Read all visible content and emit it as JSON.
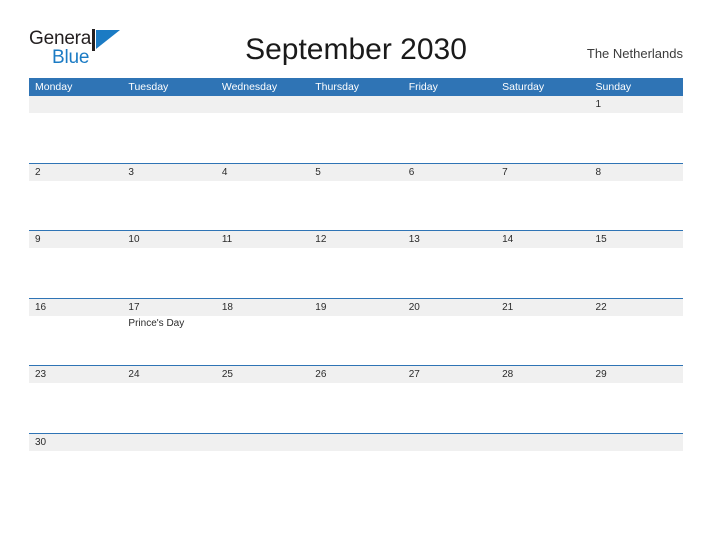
{
  "brand": {
    "name_part1": "General",
    "name_part2": "Blue",
    "flag_icon": "flag-triangle-icon",
    "color_dark": "#231f20",
    "color_blue": "#1b7bc4"
  },
  "header": {
    "title": "September 2030",
    "region": "The Netherlands"
  },
  "theme": {
    "header_blue": "#2f74b5",
    "band_gray": "#f0f0f0",
    "text_dark": "#2b2b2b",
    "page_background": "#ffffff"
  },
  "calendar": {
    "weekdays": [
      "Monday",
      "Tuesday",
      "Wednesday",
      "Thursday",
      "Friday",
      "Saturday",
      "Sunday"
    ],
    "weeks": [
      {
        "days": [
          {
            "date": "",
            "events": []
          },
          {
            "date": "",
            "events": []
          },
          {
            "date": "",
            "events": []
          },
          {
            "date": "",
            "events": []
          },
          {
            "date": "",
            "events": []
          },
          {
            "date": "",
            "events": []
          },
          {
            "date": "1",
            "events": []
          }
        ]
      },
      {
        "days": [
          {
            "date": "2",
            "events": []
          },
          {
            "date": "3",
            "events": []
          },
          {
            "date": "4",
            "events": []
          },
          {
            "date": "5",
            "events": []
          },
          {
            "date": "6",
            "events": []
          },
          {
            "date": "7",
            "events": []
          },
          {
            "date": "8",
            "events": []
          }
        ]
      },
      {
        "days": [
          {
            "date": "9",
            "events": []
          },
          {
            "date": "10",
            "events": []
          },
          {
            "date": "11",
            "events": []
          },
          {
            "date": "12",
            "events": []
          },
          {
            "date": "13",
            "events": []
          },
          {
            "date": "14",
            "events": []
          },
          {
            "date": "15",
            "events": []
          }
        ]
      },
      {
        "days": [
          {
            "date": "16",
            "events": []
          },
          {
            "date": "17",
            "events": [
              "Prince's Day"
            ]
          },
          {
            "date": "18",
            "events": []
          },
          {
            "date": "19",
            "events": []
          },
          {
            "date": "20",
            "events": []
          },
          {
            "date": "21",
            "events": []
          },
          {
            "date": "22",
            "events": []
          }
        ]
      },
      {
        "days": [
          {
            "date": "23",
            "events": []
          },
          {
            "date": "24",
            "events": []
          },
          {
            "date": "25",
            "events": []
          },
          {
            "date": "26",
            "events": []
          },
          {
            "date": "27",
            "events": []
          },
          {
            "date": "28",
            "events": []
          },
          {
            "date": "29",
            "events": []
          }
        ]
      },
      {
        "days": [
          {
            "date": "30",
            "events": []
          },
          {
            "date": "",
            "events": []
          },
          {
            "date": "",
            "events": []
          },
          {
            "date": "",
            "events": []
          },
          {
            "date": "",
            "events": []
          },
          {
            "date": "",
            "events": []
          },
          {
            "date": "",
            "events": []
          }
        ]
      }
    ]
  }
}
